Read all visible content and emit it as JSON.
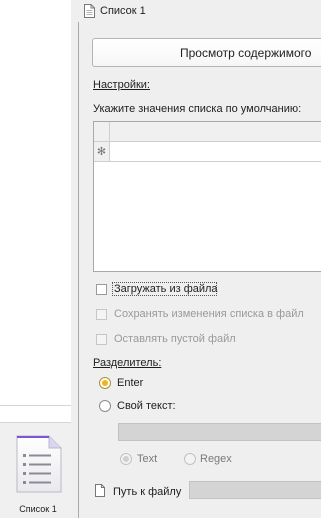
{
  "canvas": {
    "file_caption": "Список 1",
    "file_icon": "list-document-icon"
  },
  "panel": {
    "title": "Список 1",
    "title_icon": "document-icon",
    "preview_button": "Просмотр содержимого",
    "settings_label": "Настройки:",
    "defaults_label": "Укажите значения списка по умолчанию:",
    "grid": {
      "new_row_marker": "✻",
      "rows": []
    },
    "options": [
      {
        "label": "Загружать из файла",
        "checked": false,
        "enabled": true
      },
      {
        "label": "Сохранять изменения списка в файл",
        "checked": false,
        "enabled": false
      },
      {
        "label": "Оставлять пустой файл",
        "checked": false,
        "enabled": false
      }
    ],
    "separator": {
      "label": "Разделитель:",
      "enter_label": "Enter",
      "custom_label": "Свой текст:",
      "custom_value": "",
      "mode_text_label": "Text",
      "mode_regex_label": "Regex"
    },
    "file_path": {
      "label": "Путь к файлу",
      "icon": "file-icon",
      "value": ""
    },
    "colors": {
      "accent_radio": "#f0b417",
      "panel_bg": "#efefef",
      "disabled_input": "#d4d4d4"
    }
  }
}
